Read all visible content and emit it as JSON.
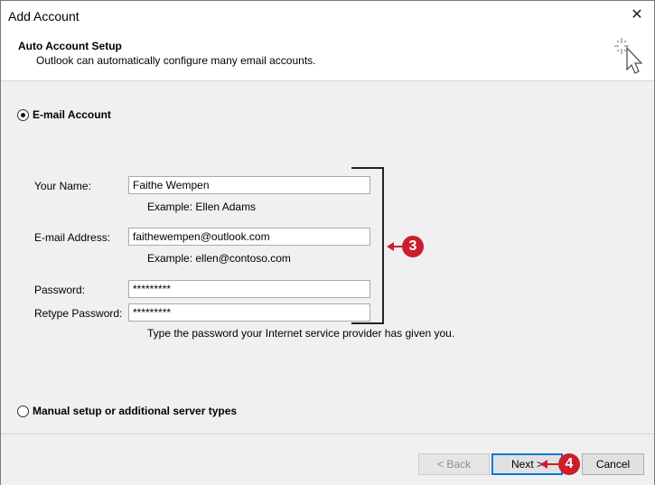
{
  "window": {
    "title": "Add Account",
    "close_glyph": "✕"
  },
  "header": {
    "title": "Auto Account Setup",
    "subtitle": "Outlook can automatically configure many email accounts.",
    "icon": "wizard-cursor-icon"
  },
  "email_account": {
    "option_label": "E-mail Account",
    "selected": true,
    "fields": {
      "name": {
        "label": "Your Name:",
        "value": "Faithe Wempen",
        "hint": "Example: Ellen Adams"
      },
      "email": {
        "label": "E-mail Address:",
        "value": "faithewempen@outlook.com",
        "hint": "Example: ellen@contoso.com"
      },
      "password": {
        "label": "Password:",
        "value": "*********"
      },
      "retype_password": {
        "label": "Retype Password:",
        "value": "*********",
        "hint": "Type the password your Internet service provider has given you."
      }
    }
  },
  "manual_setup": {
    "option_label": "Manual setup or additional server types",
    "selected": false
  },
  "callouts": {
    "fields_step": "3",
    "next_step": "4",
    "color": "#cc1e2e"
  },
  "footer": {
    "back_label": "< Back",
    "next_label": "Next >",
    "cancel_label": "Cancel"
  }
}
